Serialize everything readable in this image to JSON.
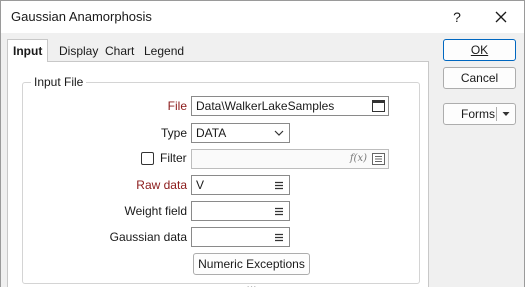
{
  "window": {
    "title": "Gaussian Anamorphosis",
    "help_glyph": "?",
    "close_glyph": "✕"
  },
  "tabs": [
    {
      "label": "Input"
    },
    {
      "label": "Display"
    },
    {
      "label": "Chart"
    },
    {
      "label": "Legend"
    }
  ],
  "input_file": {
    "group_label": "Input File",
    "file_label": "File",
    "file_value": "Data\\WalkerLakeSamples",
    "type_label": "Type",
    "type_value": "DATA",
    "filter_label": "Filter",
    "filter_value": "",
    "raw_data_label": "Raw data",
    "raw_data_value": "V",
    "weight_field_label": "Weight field",
    "weight_field_value": "",
    "gaussian_data_label": "Gaussian data",
    "gaussian_data_value": "",
    "numeric_exceptions_label": "Numeric Exceptions ..."
  },
  "side_buttons": {
    "ok_label": "OK",
    "cancel_label": "Cancel",
    "forms_label": "Forms"
  },
  "colors": {
    "required_label": "#8b1a1a",
    "accent_border": "#0067c0"
  }
}
